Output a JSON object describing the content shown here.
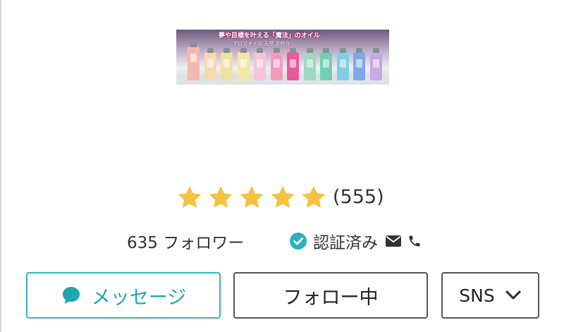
{
  "banner": {
    "caption": "夢や目標を叶える「魔法」のオイル",
    "subcaption": "アロマオイル 天然 手作り",
    "bottle_colors": [
      "#f3b8ae",
      "#f7d9b0",
      "#efe2a0",
      "#f4e7a6",
      "#f5c4d8",
      "#f49ac0",
      "#e85a9a",
      "#9ed8c0",
      "#6fd0b4",
      "#7fcfe6",
      "#7fa8e8",
      "#c7a8e8"
    ]
  },
  "rating": {
    "stars": 5,
    "max_stars": 5,
    "count": "(555)",
    "star_color": "#f5c342"
  },
  "profile": {
    "followers": "635 フォロワー",
    "verified_label": "認証済み",
    "verified_color": "#2bb0c0",
    "icons": [
      "check-circle-icon",
      "mail-icon",
      "phone-icon"
    ]
  },
  "buttons": {
    "message": "メッセージ",
    "follow": "フォロー中",
    "sns": "SNS"
  },
  "colors": {
    "accent": "#33b5b6",
    "text": "#333333",
    "border": "#555555"
  }
}
